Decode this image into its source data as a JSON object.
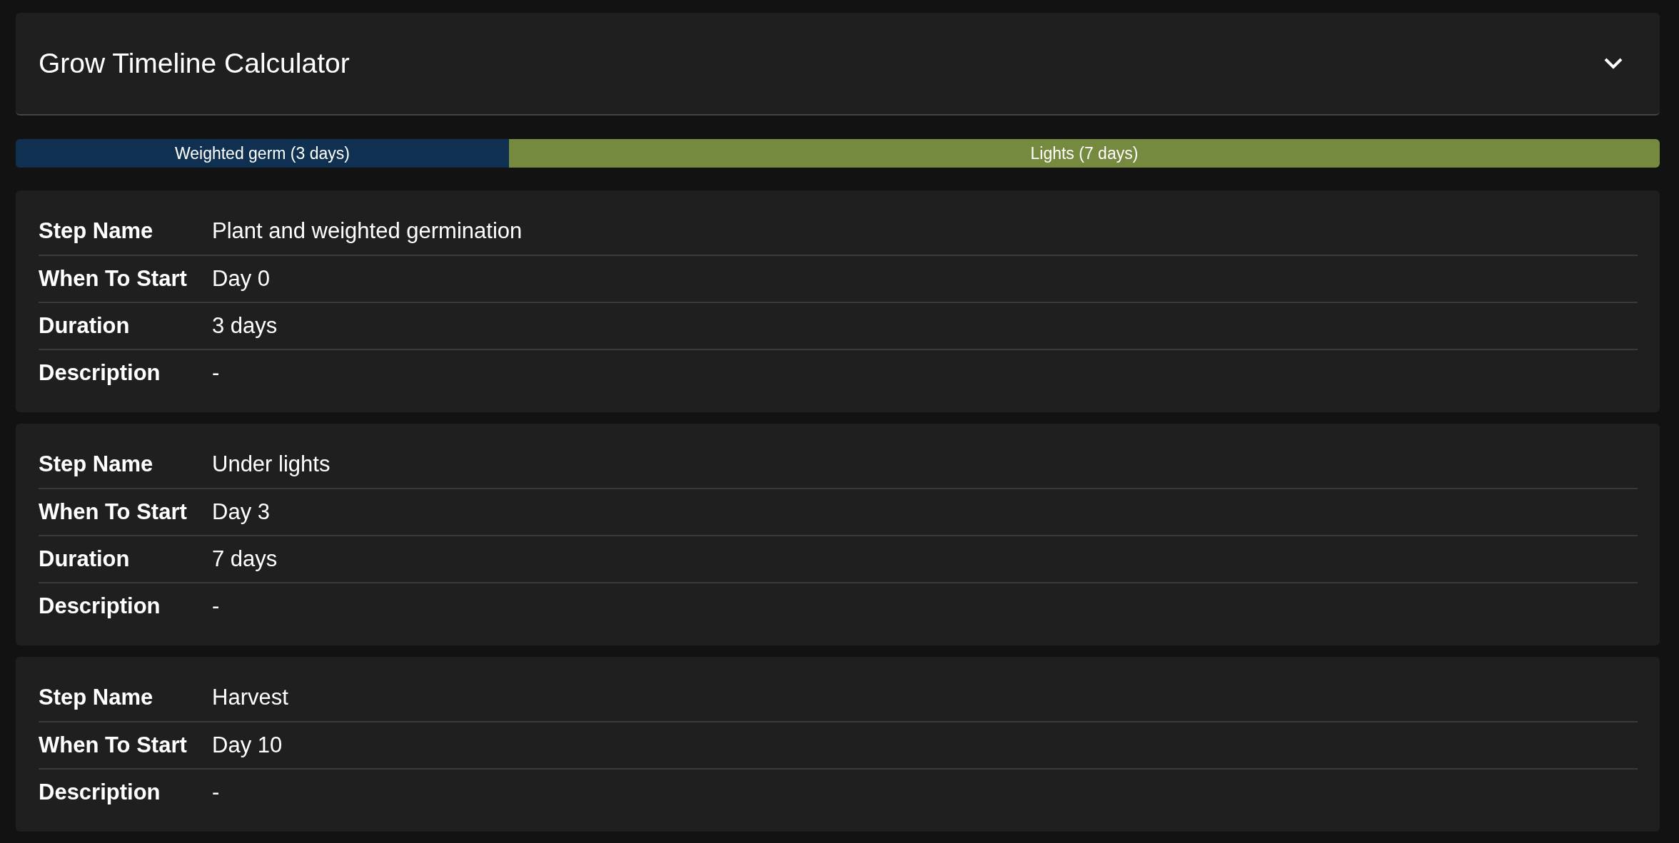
{
  "header": {
    "title": "Grow Timeline Calculator",
    "expanded": true
  },
  "timeline": [
    {
      "label": "Weighted germ (3 days)",
      "level": 0.3,
      "color": "#0f3050"
    },
    {
      "label": "Lights (7 days)",
      "level": 0.7,
      "color": "#758a3f"
    }
  ],
  "steps": [
    {
      "rows": [
        {
          "label": "Step Name",
          "value": "Plant and weighted germination"
        },
        {
          "label": "When To Start",
          "value": "Day 0"
        },
        {
          "label": "Duration",
          "value": "3 days"
        },
        {
          "label": "Description",
          "value": "-"
        }
      ]
    },
    {
      "rows": [
        {
          "label": "Step Name",
          "value": "Under lights"
        },
        {
          "label": "When To Start",
          "value": "Day 3"
        },
        {
          "label": "Duration",
          "value": "7 days"
        },
        {
          "label": "Description",
          "value": "-"
        }
      ]
    },
    {
      "rows": [
        {
          "label": "Step Name",
          "value": "Harvest"
        },
        {
          "label": "When To Start",
          "value": "Day 10"
        },
        {
          "label": "Description",
          "value": "-"
        }
      ]
    }
  ]
}
